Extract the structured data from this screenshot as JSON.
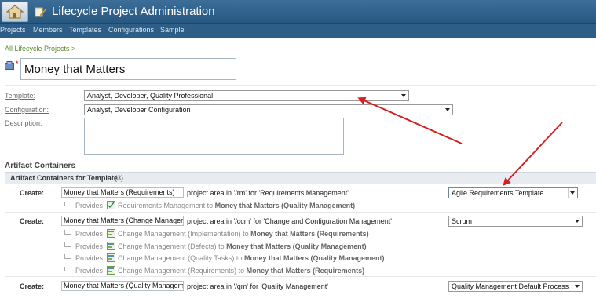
{
  "header": {
    "title": "Lifecycle Project Administration"
  },
  "nav": [
    "Projects",
    "Members",
    "Templates",
    "Configurations",
    "Sample"
  ],
  "breadcrumb": "All Lifecycle Projects >",
  "project": {
    "required_mark": "*",
    "name": "Money that Matters"
  },
  "form": {
    "template_label": "Template:",
    "template_value": "Analyst, Developer, Quality Professional",
    "configuration_label": "Configuration:",
    "configuration_value": "Analyst, Developer Configuration",
    "description_label": "Description:"
  },
  "artifacts": {
    "title": "Artifact Containers",
    "subtitle": "Artifact Containers for Template",
    "count": "(3)",
    "rows": [
      {
        "create_label": "Create:",
        "name": "Money that Matters (Requirements)",
        "description": "project area in '/rm' for 'Requirements Management'",
        "template": "Agile Requirements Template",
        "provides": [
          {
            "word": "Provides",
            "capability": "Requirements Management to",
            "target": "Money that Matters (Quality Management)"
          }
        ]
      },
      {
        "create_label": "Create:",
        "name": "Money that Matters (Change Management)",
        "description": "project area in '/ccm' for 'Change and Configuration Management'",
        "template": "Scrum",
        "provides": [
          {
            "word": "Provides",
            "capability": "Change Management (Implementation) to",
            "target": "Money that Matters (Requirements)"
          },
          {
            "word": "Provides",
            "capability": "Change Management (Defects) to",
            "target": "Money that Matters (Quality Management)"
          },
          {
            "word": "Provides",
            "capability": "Change Management (Quality Tasks) to",
            "target": "Money that Matters (Quality Management)"
          },
          {
            "word": "Provides",
            "capability": "Change Management (Requirements) to",
            "target": "Money that Matters (Requirements)"
          }
        ]
      },
      {
        "create_label": "Create:",
        "name": "Money that Matters (Quality Management)",
        "description": "project area in '/qm' for 'Quality Management'",
        "template": "Quality Management Default Process"
      }
    ]
  },
  "colors": {
    "banner": "#2f6290",
    "link_green": "#5a8b2e",
    "arrow_red": "#d42020"
  }
}
